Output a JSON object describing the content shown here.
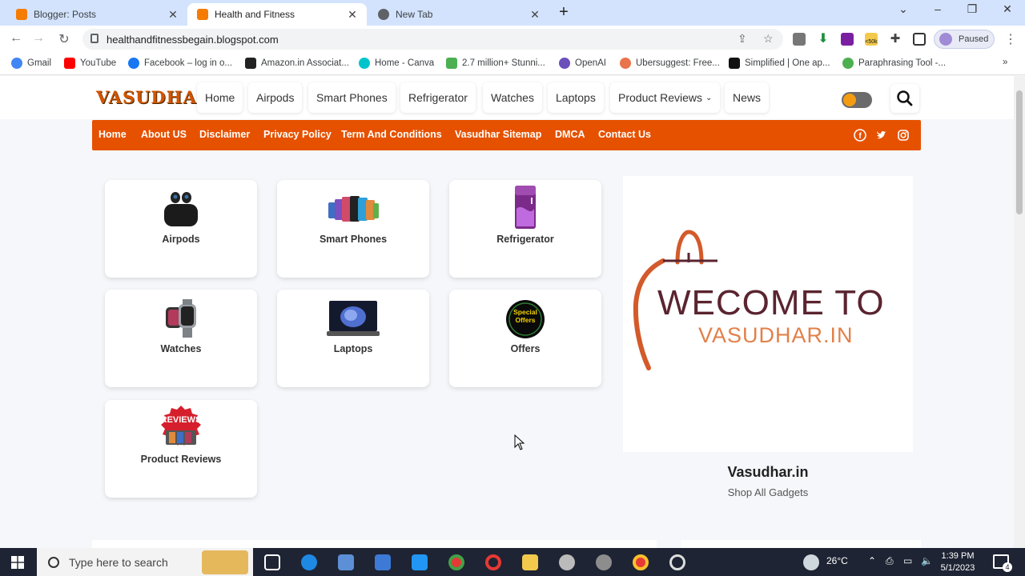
{
  "browser": {
    "tabs": [
      {
        "title": "Blogger: Posts",
        "icon_color": "#f57c00",
        "active": false
      },
      {
        "title": "Health and Fitness",
        "icon_color": "#f57c00",
        "active": true
      },
      {
        "title": "New Tab",
        "icon_color": "#5f6368",
        "active": false
      }
    ],
    "url": "healthandfitnessbegain.blogspot.com",
    "profile_label": "Paused",
    "extension_badge": "<50k",
    "bookmarks": [
      {
        "label": "Gmail",
        "icon": "google-icon",
        "color": "#4285f4"
      },
      {
        "label": "YouTube",
        "icon": "youtube-icon",
        "color": "#ff0000"
      },
      {
        "label": "Facebook – log in o...",
        "icon": "facebook-icon",
        "color": "#1877f2"
      },
      {
        "label": "Amazon.in Associat...",
        "icon": "amazon-icon",
        "color": "#222"
      },
      {
        "label": "Home - Canva",
        "icon": "canva-icon",
        "color": "#00c4cc"
      },
      {
        "label": "2.7 million+ Stunni...",
        "icon": "pixabay-icon",
        "color": "#4caf50"
      },
      {
        "label": "OpenAI",
        "icon": "openai-icon",
        "color": "#6b4fbb"
      },
      {
        "label": "Ubersuggest: Free...",
        "icon": "ubersuggest-icon",
        "color": "#e9734d"
      },
      {
        "label": "Simplified | One ap...",
        "icon": "simplified-icon",
        "color": "#111"
      },
      {
        "label": "Paraphrasing Tool -...",
        "icon": "quillbot-icon",
        "color": "#4caf50"
      }
    ]
  },
  "site": {
    "logo": "VASUDHAR",
    "nav": [
      "Home",
      "Airpods",
      "Smart Phones",
      "Refrigerator",
      "Watches",
      "Laptops",
      "Product Reviews",
      "News"
    ],
    "secondary_nav": [
      "Home",
      "About US",
      "Disclaimer",
      "Privacy Policy",
      "Term And Conditions",
      "Vasudhar Sitemap",
      "DMCA",
      "Contact Us"
    ],
    "social": [
      "facebook-icon",
      "twitter-icon",
      "instagram-icon"
    ],
    "categories": [
      {
        "label": "Airpods",
        "icon": "airpods-icon"
      },
      {
        "label": "Smart Phones",
        "icon": "smartphones-icon"
      },
      {
        "label": "Refrigerator",
        "icon": "refrigerator-icon"
      },
      {
        "label": "Watches",
        "icon": "watch-icon"
      },
      {
        "label": "Laptops",
        "icon": "laptop-icon"
      },
      {
        "label": "Offers",
        "icon": "special-offers-icon",
        "badge": "Special Offers"
      },
      {
        "label": "Product Reviews",
        "icon": "reviews-icon",
        "badge": "REVIEWS"
      }
    ],
    "banner": {
      "line1": "WECOME TO",
      "line2": "VASUDHAR.IN"
    },
    "site_name": "Vasudhar.in",
    "site_tagline": "Shop All Gadgets",
    "accent_color": "#e65100"
  },
  "taskbar": {
    "search_placeholder": "Type here to search",
    "temperature": "26°C",
    "time": "1:39 PM",
    "date": "5/1/2023",
    "notification_count": "4"
  }
}
